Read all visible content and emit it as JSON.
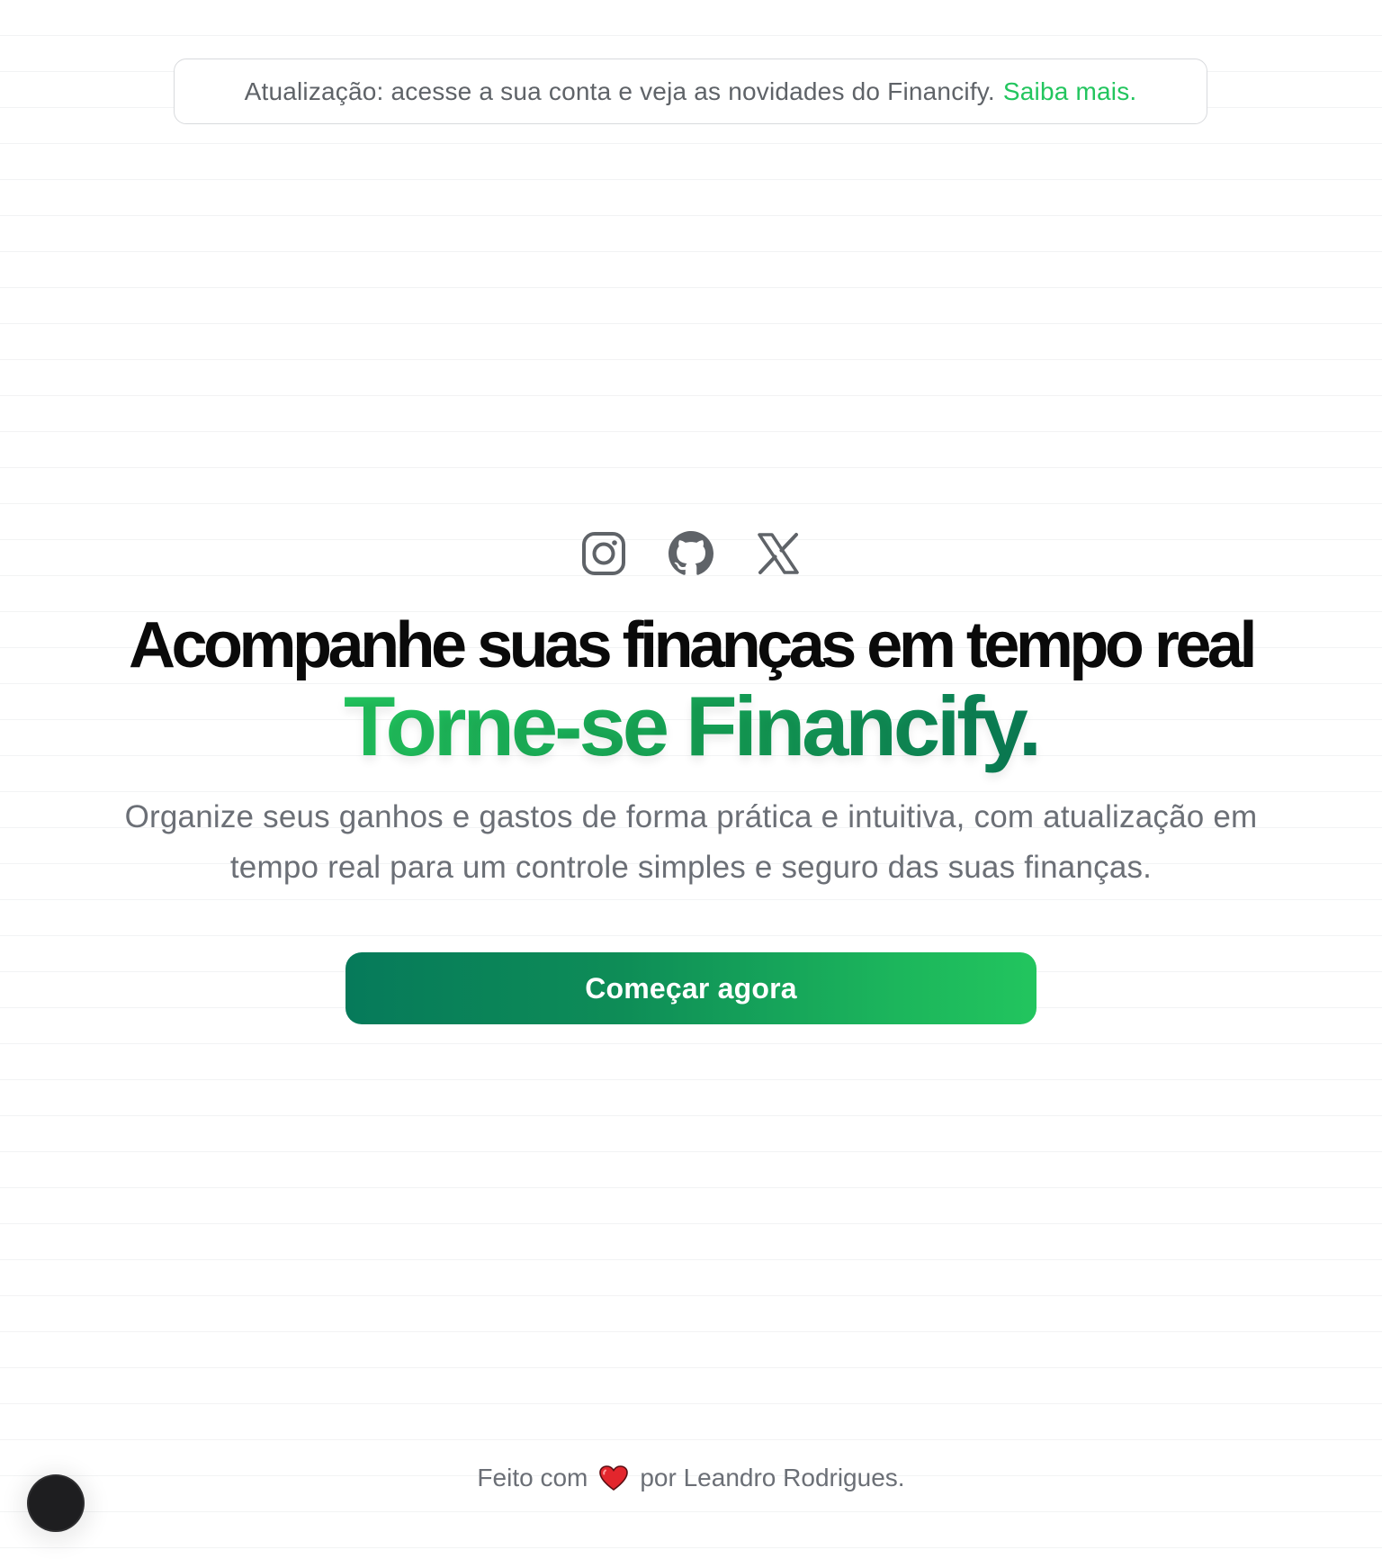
{
  "announcement": {
    "text": "Atualização: acesse a sua conta e veja as novidades do Financify.",
    "link_label": "Saiba mais."
  },
  "social_links": [
    {
      "name": "instagram-icon"
    },
    {
      "name": "github-icon"
    },
    {
      "name": "x-icon"
    }
  ],
  "hero": {
    "headline": "Acompanhe suas finanças em tempo real",
    "brand_line": "Torne-se Financify.",
    "subtitle": "Organize seus ganhos e gastos de forma prática e intuitiva, com atualização em tempo real para um controle simples e seguro das suas finanças.",
    "cta_label": "Começar agora"
  },
  "footer": {
    "before": "Feito com",
    "icon": "heart-icon",
    "after": "por Leandro Rodrigues."
  },
  "colors": {
    "accent": "#22c55e",
    "accent_dark": "#067a5a",
    "text_dark": "#0a0a0a",
    "text_muted": "#6b6f76"
  }
}
